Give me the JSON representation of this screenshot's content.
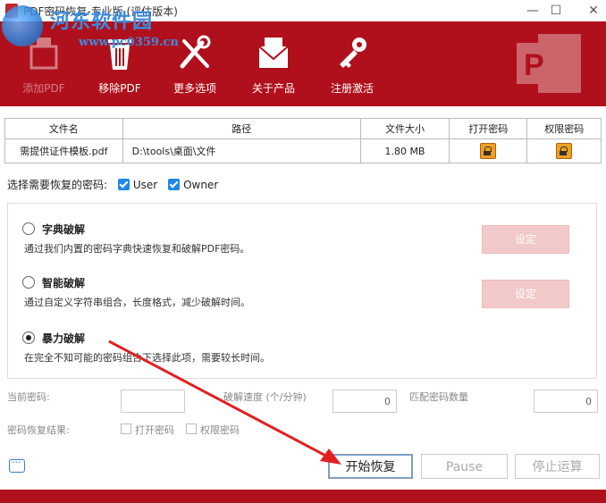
{
  "window": {
    "title": "PDF密码恢复-专业版 (评估版本)",
    "minimize": "—",
    "maximize": "☐",
    "close": "✕"
  },
  "watermark": {
    "site_name": "河东软件园",
    "url": "www.pc0359.cn"
  },
  "toolbar": {
    "items": [
      {
        "label": "添加PDF",
        "icon": "add-pdf-icon",
        "enabled": false
      },
      {
        "label": "移除PDF",
        "icon": "trash-icon",
        "enabled": true
      },
      {
        "label": "更多选项",
        "icon": "tools-icon",
        "enabled": true
      },
      {
        "label": "关于产品",
        "icon": "envelope-icon",
        "enabled": true
      },
      {
        "label": "注册激活",
        "icon": "key-icon",
        "enabled": true
      }
    ],
    "bg_color": "#b0101c"
  },
  "file_table": {
    "headers": [
      "文件名",
      "路径",
      "文件大小",
      "打开密码",
      "权限密码"
    ],
    "rows": [
      {
        "name": "需提供证件模板.pdf",
        "path": "D:\\tools\\桌面\\文件",
        "size": "1.80 MB",
        "open_lock": "lock-icon",
        "perm_lock": "lock-icon"
      }
    ]
  },
  "select": {
    "label": "选择需要恢复的密码:",
    "user": "User",
    "owner": "Owner"
  },
  "modes": [
    {
      "name": "字典破解",
      "desc": "通过我们内置的密码字典快速恢复和破解PDF密码。",
      "button": "设定",
      "selected": false
    },
    {
      "name": "智能破解",
      "desc": "通过自定义字符串组合，长度格式，减少破解时间。",
      "button": "设定",
      "selected": false
    },
    {
      "name": "暴力破解",
      "desc": "在完全不知可能的密码组合下选择此项，需要较长时间。",
      "selected": true
    }
  ],
  "stats": {
    "current_label": "当前密码:",
    "speed_label": "破解速度 (个/分钟)",
    "speed_value": "0",
    "match_label": "匹配密码数量",
    "match_value": "0",
    "result_label": "密码恢复结果:",
    "open_pw": "打开密码",
    "perm_pw": "权限密码"
  },
  "actions": {
    "start": "开始恢复",
    "pause": "Pause",
    "stop": "停止运算"
  }
}
